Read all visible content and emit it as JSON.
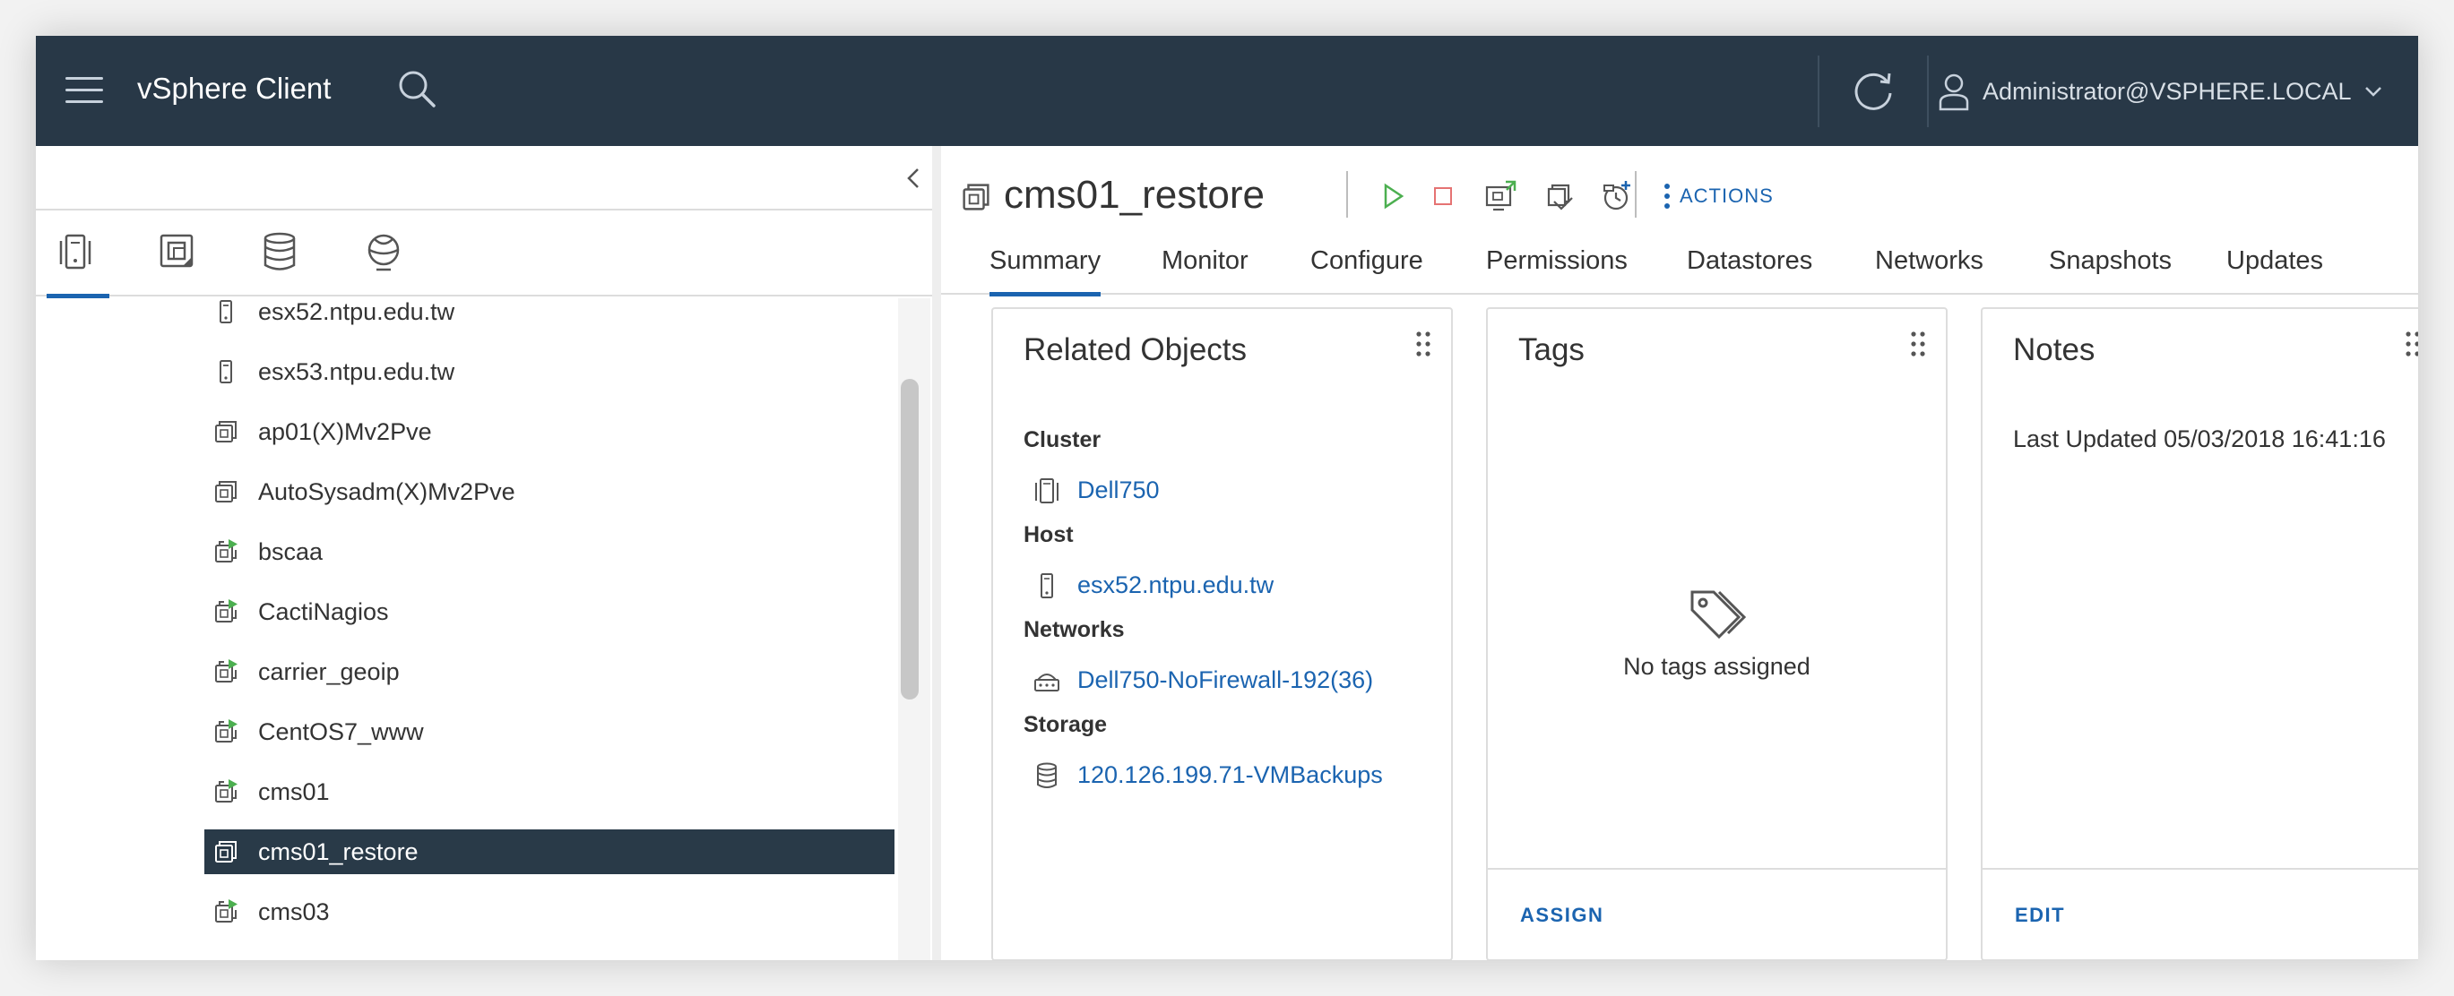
{
  "header": {
    "app_title": "vSphere Client",
    "user": "Administrator@VSPHERE.LOCAL"
  },
  "nav": {
    "tabs": [
      "hosts-and-clusters-icon",
      "vms-and-templates-icon",
      "storage-icon",
      "networking-icon"
    ],
    "active_tab": 0
  },
  "tree": {
    "items": [
      {
        "label": "esx52.ntpu.edu.tw",
        "icon": "host-icon"
      },
      {
        "label": "esx53.ntpu.edu.tw",
        "icon": "host-icon"
      },
      {
        "label": "ap01(X)Mv2Pve",
        "icon": "vm-icon"
      },
      {
        "label": "AutoSysadm(X)Mv2Pve",
        "icon": "vm-icon"
      },
      {
        "label": "bscaa",
        "icon": "vm-powered-on-icon"
      },
      {
        "label": "CactiNagios",
        "icon": "vm-powered-on-icon"
      },
      {
        "label": "carrier_geoip",
        "icon": "vm-powered-on-icon"
      },
      {
        "label": "CentOS7_www",
        "icon": "vm-powered-on-icon"
      },
      {
        "label": "cms01",
        "icon": "vm-powered-on-icon"
      },
      {
        "label": "cms01_restore",
        "icon": "vm-icon",
        "selected": true
      },
      {
        "label": "cms03",
        "icon": "vm-powered-on-icon"
      }
    ]
  },
  "object": {
    "name": "cms01_restore",
    "actions_label": "ACTIONS"
  },
  "tabs": [
    "Summary",
    "Monitor",
    "Configure",
    "Permissions",
    "Datastores",
    "Networks",
    "Snapshots",
    "Updates"
  ],
  "active_tab": "Summary",
  "related": {
    "title": "Related Objects",
    "cluster_heading": "Cluster",
    "cluster": "Dell750",
    "host_heading": "Host",
    "host": "esx52.ntpu.edu.tw",
    "networks_heading": "Networks",
    "network": "Dell750-NoFirewall-192(36)",
    "storage_heading": "Storage",
    "storage": "120.126.199.71-VMBackups"
  },
  "tags": {
    "title": "Tags",
    "empty_text": "No tags assigned",
    "action": "ASSIGN"
  },
  "notes": {
    "title": "Notes",
    "text": "Last Updated 05/03/2018 16:41:16",
    "action": "EDIT"
  },
  "colors": {
    "header_bg": "#283847",
    "accent": "#1b64b0",
    "selected_bg": "#293a48",
    "power_on": "#4caf50",
    "power_off": "#e57373"
  }
}
